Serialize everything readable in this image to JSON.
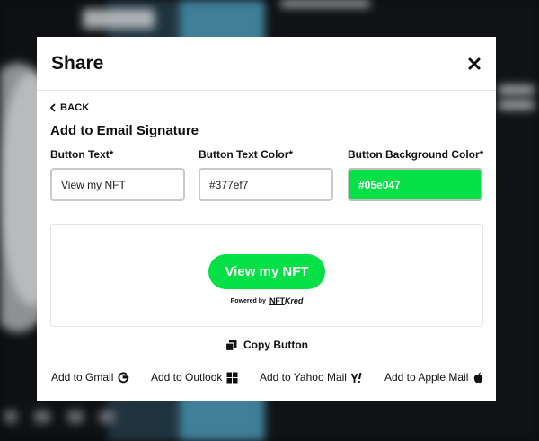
{
  "modal": {
    "title": "Share",
    "close_icon": "close-icon"
  },
  "back": {
    "label": "BACK"
  },
  "section": {
    "title": "Add to Email Signature"
  },
  "fields": {
    "button_text": {
      "label": "Button Text*",
      "value": "View my NFT"
    },
    "text_color": {
      "label": "Button Text Color*",
      "value": "#377ef7"
    },
    "bg_color": {
      "label": "Button Background Color*",
      "value": "#05e047"
    }
  },
  "preview": {
    "button_label": "View my NFT",
    "powered_by": "Powered by",
    "brand_nft": "NFT",
    "brand_kred": "Kred"
  },
  "copy": {
    "label": "Copy Button"
  },
  "footer": {
    "gmail": "Add to Gmail",
    "outlook": "Add to Outlook",
    "yahoo": "Add to Yahoo Mail",
    "apple": "Add to Apple Mail"
  },
  "colors": {
    "accent_green": "#05e047",
    "text_color_value": "#377ef7"
  }
}
